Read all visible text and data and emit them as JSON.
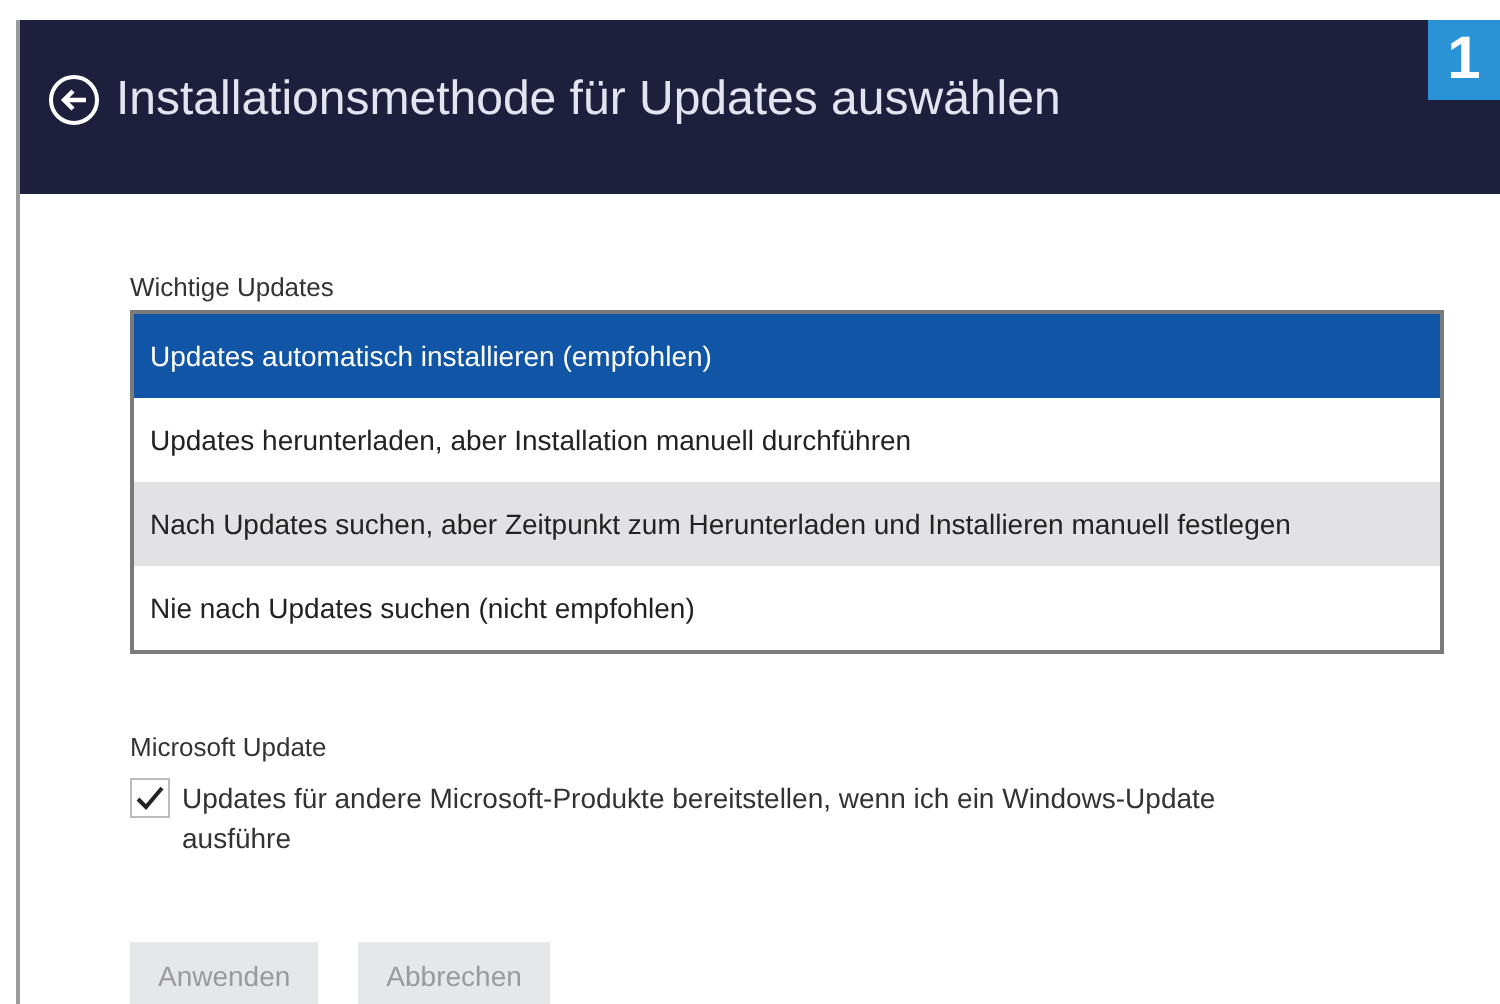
{
  "header": {
    "title": "Installationsmethode für Updates auswählen",
    "badge": "1"
  },
  "important_updates": {
    "label": "Wichtige Updates",
    "options": [
      {
        "label": "Updates automatisch installieren (empfohlen)",
        "selected": true,
        "hovered": false
      },
      {
        "label": "Updates herunterladen, aber Installation manuell durchführen",
        "selected": false,
        "hovered": false
      },
      {
        "label": "Nach Updates suchen, aber Zeitpunkt zum Herunterladen und Installieren manuell festlegen",
        "selected": false,
        "hovered": true
      },
      {
        "label": "Nie nach Updates suchen (nicht empfohlen)",
        "selected": false,
        "hovered": false
      }
    ]
  },
  "microsoft_update": {
    "label": "Microsoft Update",
    "checkbox": {
      "label": "Updates für andere Microsoft-Produkte bereitstellen, wenn ich ein Windows-Update ausführe",
      "checked": true
    }
  },
  "buttons": [
    {
      "label": "Anwenden",
      "disabled": true
    },
    {
      "label": "Abbrechen",
      "disabled": true
    }
  ]
}
